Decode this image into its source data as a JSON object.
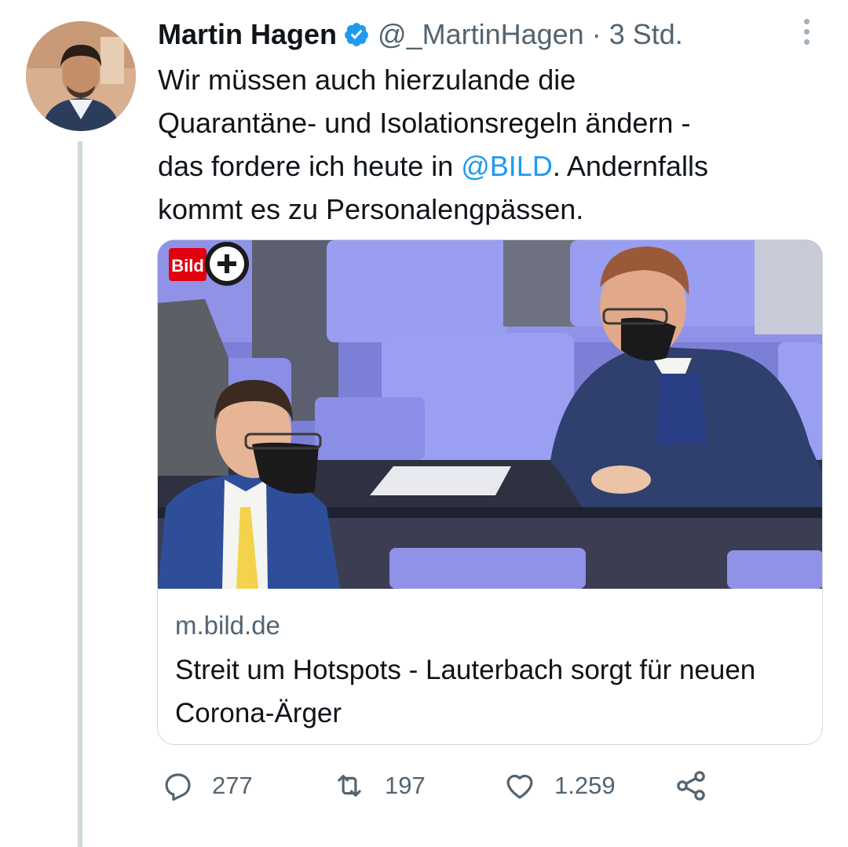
{
  "author": {
    "name": "Martin Hagen",
    "handle": "@_MartinHagen",
    "separator": "·",
    "time": "3 Std."
  },
  "tweet": {
    "text_line1": "Wir müssen auch hierzulande die",
    "text_line2": "Quarantäne- und Isolationsregeln ändern -",
    "text_line3a": "das fordere ich heute in ",
    "mention": "@BILD",
    "text_line3b": ". Andernfalls",
    "text_line4": "kommt es zu Personalengpässen."
  },
  "card": {
    "badge": "Bild",
    "domain": "m.bild.de",
    "title": "Streit um Hotspots - Lauterbach sorgt für neuen Corona-Ärger"
  },
  "actions": {
    "replies": "277",
    "retweets": "197",
    "likes": "1.259"
  },
  "colors": {
    "link": "#1d9bf0",
    "muted": "#536471",
    "verified": "#1d9bf0",
    "bild_red": "#e3000f"
  },
  "icons": [
    "verified-badge-icon",
    "more-icon",
    "reply-icon",
    "retweet-icon",
    "like-icon",
    "share-icon",
    "bild-plus-icon"
  ]
}
